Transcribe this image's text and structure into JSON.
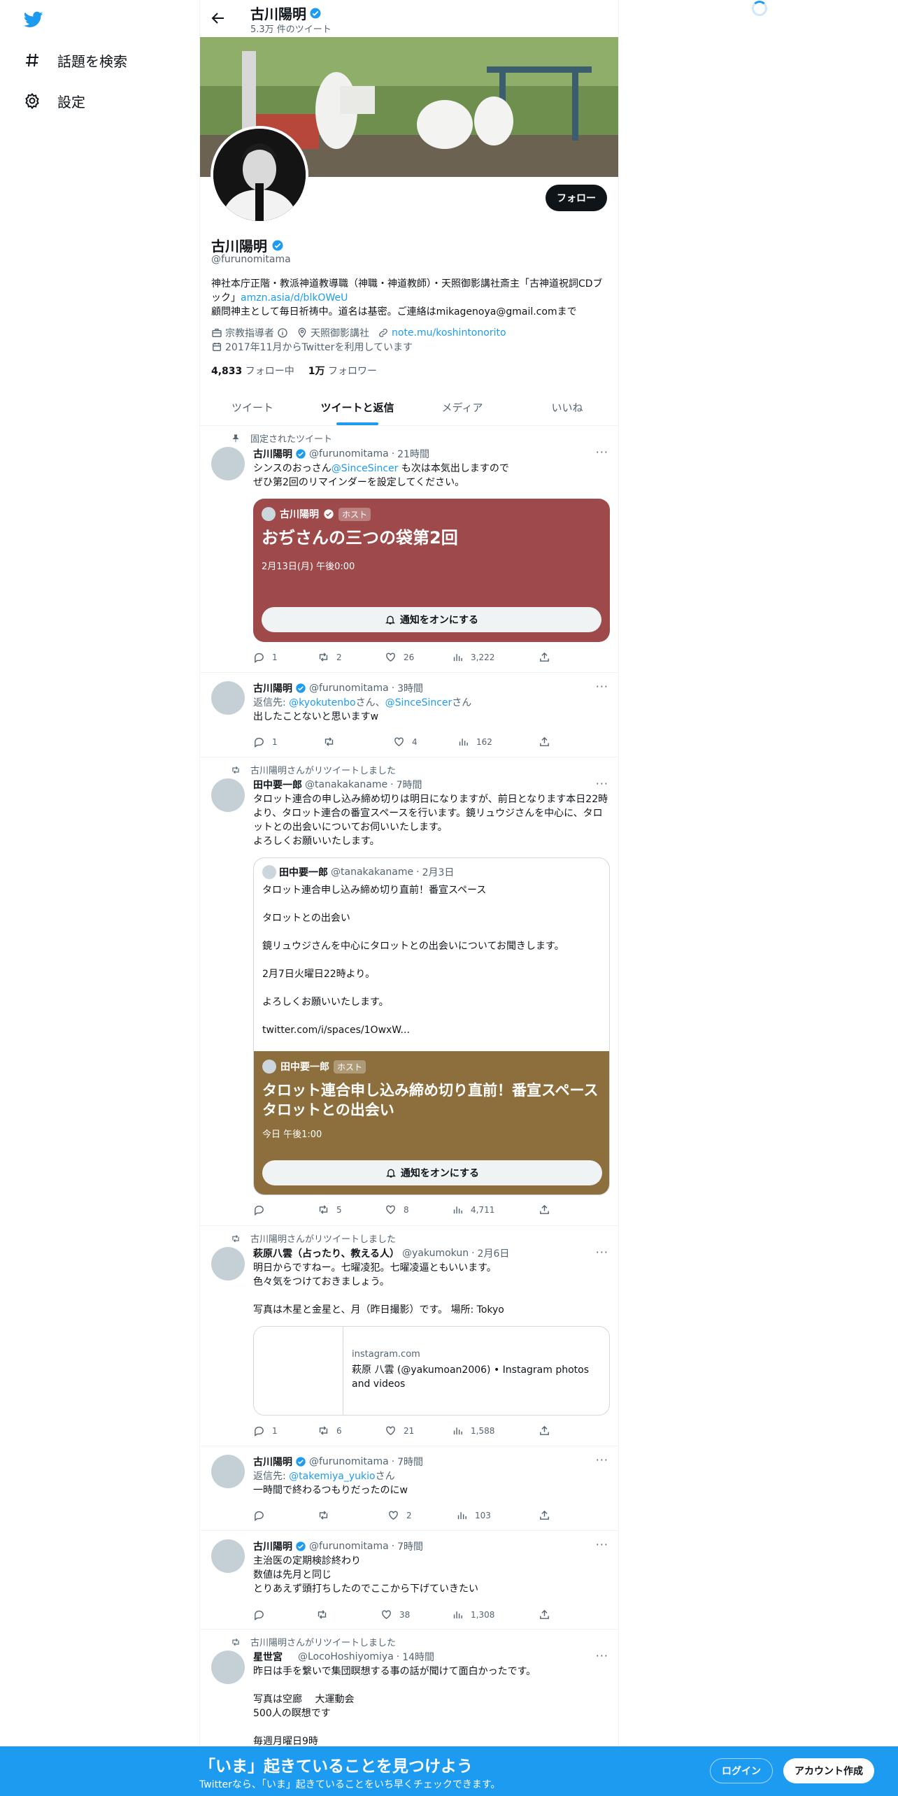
{
  "sidebar": {
    "items": [
      {
        "label": "話題を検索",
        "icon": "hashtag-icon"
      },
      {
        "label": "設定",
        "icon": "gear-icon"
      }
    ]
  },
  "header": {
    "name": "古川陽明",
    "tweet_count": "5.3万 件のツイート"
  },
  "profile": {
    "name": "古川陽明",
    "handle": "@furunomitama",
    "follow_label": "フォロー",
    "bio_1": "神社本庁正階・教派神道教導職（神職・神道教師）・天照御影講社斎主「古神道祝詞CDブック」",
    "bio_link": "amzn.asia/d/blkOWeU",
    "bio_2": "顧問神主として毎日祈祷中。道名は基密。ご連絡はmikagenoya@gmail.comまで",
    "category": "宗教指導者",
    "location": "天照御影講社",
    "website": "note.mu/koshintonorito",
    "joined": "2017年11月からTwitterを利用しています",
    "following_count": "4,833",
    "following_label": "フォロー中",
    "followers_count": "1万",
    "followers_label": "フォロワー"
  },
  "tabs": [
    "ツイート",
    "ツイートと返信",
    "メディア",
    "いいね"
  ],
  "tweets": [
    {
      "context": "固定されたツイート",
      "name": "古川陽明",
      "handle": "@furunomitama",
      "time": "21時間",
      "text_1": "シンスのおっさん",
      "mention": "@SinceSincer",
      "text_2": " も次は本気出しますので\nぜひ第2回のリマインダーを設定してください。",
      "space": {
        "host": "古川陽明",
        "host_tag": "ホスト",
        "title": "おぢさんの三つの袋第2回",
        "date": "2月13日(月) 午後0:00",
        "button": "通知をオンにする"
      },
      "reply": "1",
      "retweet": "2",
      "like": "26",
      "views": "3,222"
    },
    {
      "name": "古川陽明",
      "handle": "@furunomitama",
      "time": "3時間",
      "reply_to_label": "返信先: ",
      "reply_to_1": "@kyokutenbo",
      "reply_to_mid": "さん、",
      "reply_to_2": "@SinceSincer",
      "reply_to_end": "さん",
      "text": "出したことないと思いますw",
      "reply": "1",
      "retweet": "",
      "like": "4",
      "views": "162"
    },
    {
      "context": "古川陽明さんがリツイートしました",
      "name": "田中要一郎",
      "handle": "@tanakakaname",
      "time": "7時間",
      "text": "タロット連合の申し込み締め切りは明日になりますが、前日となります本日22時より、タロット連合の番宣スペースを行います。鏡リュウジさんを中心に、タロットとの出会いについてお伺いいたします。\nよろしくお願いいたします。",
      "quote": {
        "name": "田中要一郎",
        "handle": "@tanakakaname",
        "time": "2月3日",
        "text": "タロット連合申し込み締め切り直前！番宣スペース\n\nタロットとの出会い\n\n鏡リュウジさんを中心にタロットとの出会いについてお聞きします。\n\n2月7日火曜日22時より。\n\nよろしくお願いいたします。\n\ntwitter.com/i/spaces/1OwxW...",
        "space": {
          "host": "田中要一郎",
          "host_tag": "ホスト",
          "title": "タロット連合申し込み締め切り直前！番宣スペースタロットとの出会い",
          "date": "今日 午後1:00",
          "button": "通知をオンにする"
        }
      },
      "reply": "",
      "retweet": "5",
      "like": "8",
      "views": "4,711"
    },
    {
      "context": "古川陽明さんがリツイートしました",
      "name": "萩原八雲（占ったり、教える人）",
      "handle": "@yakumokun",
      "time": "2月6日",
      "text": "明日からですねー。七曜凌犯。七曜凌逼ともいいます。\n色々気をつけておきましょう。\n\n写真は木星と金星と、月（昨日撮影）です。 場所: Tokyo",
      "card": {
        "domain": "instagram.com",
        "title": "萩原 八雲 (@yakumoan2006) • Instagram photos and videos"
      },
      "reply": "1",
      "retweet": "6",
      "like": "21",
      "views": "1,588"
    },
    {
      "name": "古川陽明",
      "handle": "@furunomitama",
      "time": "7時間",
      "reply_to_label": "返信先: ",
      "reply_to_1": "@takemiya_yukio",
      "reply_to_end": "さん",
      "text": "一時間で終わるつもりだったのにw",
      "reply": "",
      "retweet": "",
      "like": "2",
      "views": "103"
    },
    {
      "name": "古川陽明",
      "handle": "@furunomitama",
      "time": "7時間",
      "text": "主治医の定期検診終わり\n数値は先月と同じ\nとりあえず頭打ちしたのでここから下げていきたい",
      "reply": "",
      "retweet": "",
      "like": "38",
      "views": "1,308"
    },
    {
      "context": "古川陽明さんがリツイートしました",
      "name": "星世宮",
      "handle": "@LocoHoshiyomiya",
      "time": "14時間",
      "text": "昨日は手を繋いで集団瞑想する事の話が聞けて面白かったです。\n\n写真は空廊　 大運動会\n500人の瞑想です\n\n毎週月曜日9時"
    }
  ],
  "footer": {
    "title": "「いま」起きていることを見つけよう",
    "subtitle": "Twitterなら、「いま」起きていることをいち早くチェックできます。",
    "login": "ログイン",
    "signup": "アカウント作成"
  },
  "colors": {
    "accent": "#1d9bf0",
    "space_red": "#9e4a4a",
    "space_brown": "#8d6f3e",
    "text": "#0f1419",
    "muted": "#536471"
  }
}
